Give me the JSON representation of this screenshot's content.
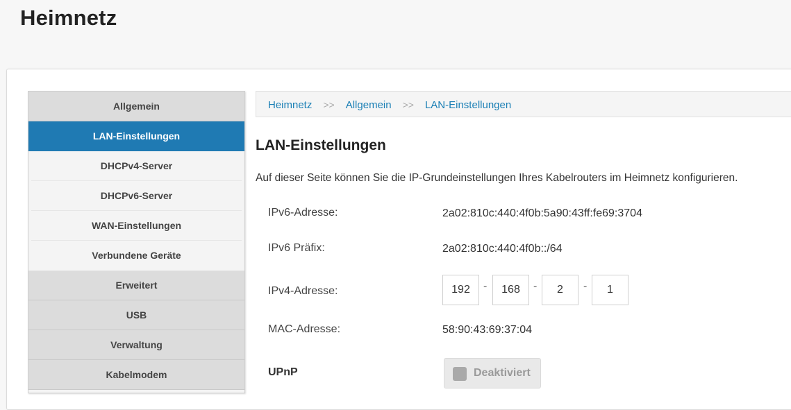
{
  "header": {
    "title": "Heimnetz"
  },
  "sidebar": {
    "items": [
      {
        "label": "Allgemein"
      },
      {
        "label": "LAN-Einstellungen"
      },
      {
        "label": "DHCPv4-Server"
      },
      {
        "label": "DHCPv6-Server"
      },
      {
        "label": "WAN-Einstellungen"
      },
      {
        "label": "Verbundene Geräte"
      },
      {
        "label": "Erweitert"
      },
      {
        "label": "USB"
      },
      {
        "label": "Verwaltung"
      },
      {
        "label": "Kabelmodem"
      }
    ]
  },
  "breadcrumb": {
    "items": [
      "Heimnetz",
      "Allgemein",
      "LAN-Einstellungen"
    ],
    "separator": ">>"
  },
  "main": {
    "title": "LAN-Einstellungen",
    "intro": "Auf dieser Seite können Sie die IP-Grundeinstellungen Ihres Kabelrouters im Heimnetz konfigurieren.",
    "ipv6_label": "IPv6-Adresse:",
    "ipv6_value": "2a02:810c:440:4f0b:5a90:43ff:fe69:3704",
    "prefix_label": "IPv6 Präfix:",
    "prefix_value": "2a02:810c:440:4f0b::/64",
    "ipv4_label": "IPv4-Adresse:",
    "ipv4_octets": [
      "192",
      "168",
      "2",
      "1"
    ],
    "ipv4_separator": "-",
    "mac_label": "MAC-Adresse:",
    "mac_value": "58:90:43:69:37:04",
    "upnp_label": "UPnP",
    "upnp_state": "Deaktiviert"
  },
  "colors": {
    "accent": "#1f7ab3",
    "link": "#1a7fb5"
  }
}
